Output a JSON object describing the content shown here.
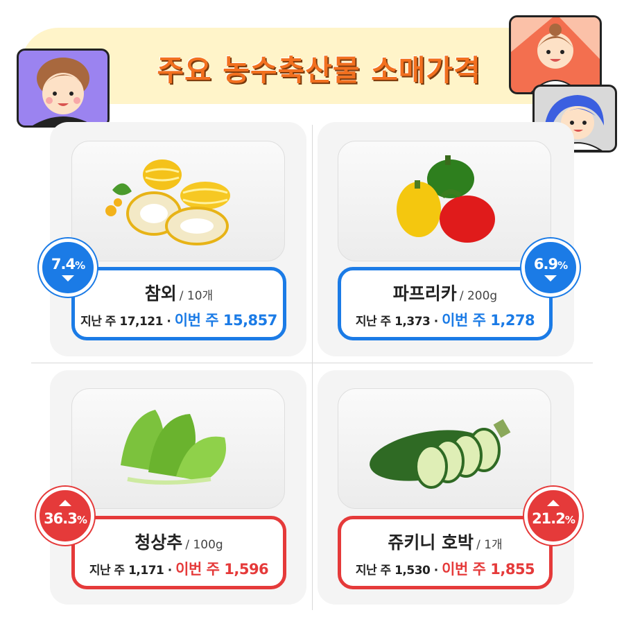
{
  "header": {
    "title": "주요 농수축산물 소매가격"
  },
  "items": [
    {
      "name": "참외",
      "unit": "/ 10개",
      "last_week": "지난 주 17,121 ·",
      "this_week": "이번 주 15,857",
      "change": "7.4",
      "pct_sign": "%",
      "direction": "down",
      "photo": "korean-melon-photo"
    },
    {
      "name": "파프리카",
      "unit": "/ 200g",
      "last_week": "지난 주 1,373 ·",
      "this_week": "이번 주 1,278",
      "change": "6.9",
      "pct_sign": "%",
      "direction": "down",
      "photo": "paprika-photo"
    },
    {
      "name": "청상추",
      "unit": "/ 100g",
      "last_week": "지난 주 1,171 ·",
      "this_week": "이번 주 1,596",
      "change": "36.3",
      "pct_sign": "%",
      "direction": "up",
      "photo": "lettuce-photo"
    },
    {
      "name": "쥬키니 호박",
      "unit": "/ 1개",
      "last_week": "지난 주 1,530 ·",
      "this_week": "이번 주 1,855",
      "change": "21.2",
      "pct_sign": "%",
      "direction": "up",
      "photo": "zucchini-photo"
    }
  ],
  "colors": {
    "down": "#1b7be6",
    "up": "#e53a3a",
    "title": "#f2701f",
    "banner": "#fff4c9"
  }
}
